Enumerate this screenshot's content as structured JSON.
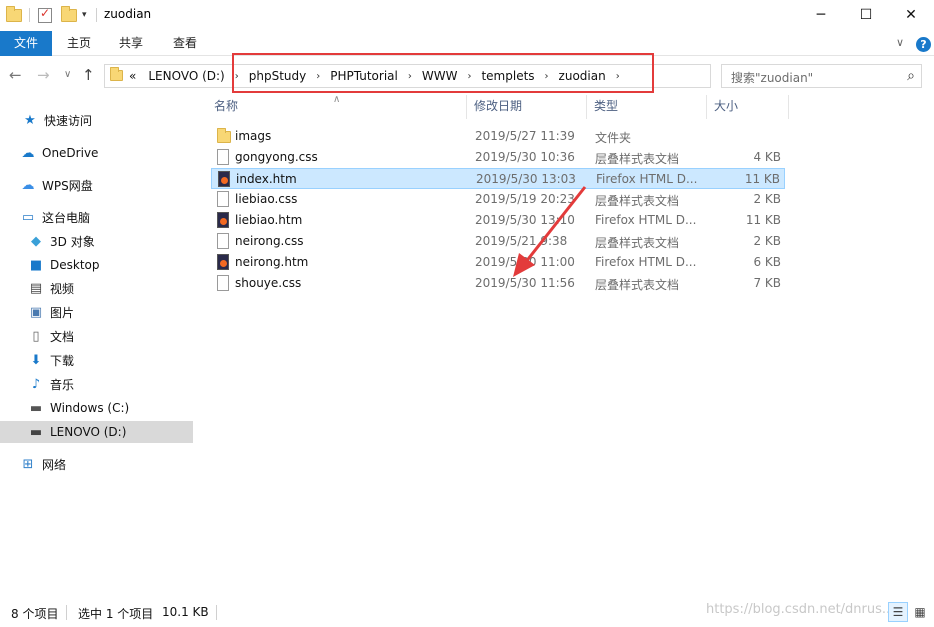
{
  "window": {
    "title": "zuodian",
    "minimize_glyph": "─",
    "maximize_glyph": "☐",
    "close_glyph": "✕"
  },
  "ribbon": {
    "tabs": [
      "文件",
      "主页",
      "共享",
      "查看"
    ],
    "expand_glyph": "∨",
    "help_glyph": "?"
  },
  "nav": {
    "back": "←",
    "forward": "→",
    "recent": "∨",
    "up": "↑"
  },
  "address": {
    "overflow": "«",
    "crumbs": [
      "LENOVO (D:)",
      "phpStudy",
      "PHPTutorial",
      "WWW",
      "templets",
      "zuodian"
    ],
    "separator": "›",
    "dropdown": "∨",
    "refresh": "↻"
  },
  "search": {
    "placeholder": "搜索\"zuodian\"",
    "icon": "search-icon"
  },
  "sidebar": {
    "items": [
      {
        "label": "快速访问",
        "icon": "star-icon"
      },
      {
        "label": "OneDrive",
        "icon": "cloud-icon"
      },
      {
        "label": "WPS网盘",
        "icon": "wps-cloud-icon"
      },
      {
        "label": "这台电脑",
        "icon": "computer-icon"
      },
      {
        "label": "3D 对象",
        "icon": "cube-icon"
      },
      {
        "label": "Desktop",
        "icon": "desktop-icon"
      },
      {
        "label": "视频",
        "icon": "video-icon"
      },
      {
        "label": "图片",
        "icon": "picture-icon"
      },
      {
        "label": "文档",
        "icon": "document-icon"
      },
      {
        "label": "下载",
        "icon": "download-icon"
      },
      {
        "label": "音乐",
        "icon": "music-icon"
      },
      {
        "label": "Windows (C:)",
        "icon": "drive-icon"
      },
      {
        "label": "LENOVO (D:)",
        "icon": "drive-icon"
      },
      {
        "label": "网络",
        "icon": "network-icon"
      }
    ]
  },
  "columns": {
    "name": "名称",
    "date": "修改日期",
    "type": "类型",
    "size": "大小",
    "sort_indicator": "∧"
  },
  "files": [
    {
      "name": "imags",
      "date": "2019/5/27 11:39",
      "type": "文件夹",
      "size": "",
      "kind": "folder"
    },
    {
      "name": "gongyong.css",
      "date": "2019/5/30 10:36",
      "type": "层叠样式表文档",
      "size": "4 KB",
      "kind": "css"
    },
    {
      "name": "index.htm",
      "date": "2019/5/30 13:03",
      "type": "Firefox HTML D...",
      "size": "11 KB",
      "kind": "htm",
      "selected": true
    },
    {
      "name": "liebiao.css",
      "date": "2019/5/19 20:23",
      "type": "层叠样式表文档",
      "size": "2 KB",
      "kind": "css"
    },
    {
      "name": "liebiao.htm",
      "date": "2019/5/30 13:10",
      "type": "Firefox HTML D...",
      "size": "11 KB",
      "kind": "htm"
    },
    {
      "name": "neirong.css",
      "date": "2019/5/21 9:38",
      "type": "层叠样式表文档",
      "size": "2 KB",
      "kind": "css"
    },
    {
      "name": "neirong.htm",
      "date": "2019/5/30 11:00",
      "type": "Firefox HTML D...",
      "size": "6 KB",
      "kind": "htm"
    },
    {
      "name": "shouye.css",
      "date": "2019/5/30 11:56",
      "type": "层叠样式表文档",
      "size": "7 KB",
      "kind": "css"
    }
  ],
  "status": {
    "count": "8 个项目",
    "selection": "选中 1 个项目",
    "selection_size": "10.1 KB",
    "watermark": "https://blog.csdn.net/dnrus..."
  },
  "colors": {
    "accent": "#1979ca",
    "selection_bg": "#cce8ff",
    "annotation_red": "#e33b3b"
  }
}
